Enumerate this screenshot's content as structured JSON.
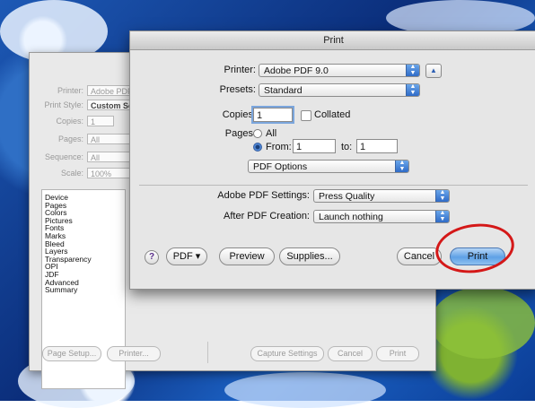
{
  "back_dialog": {
    "fields": [
      {
        "label": "Printer:",
        "value": "Adobe PDF"
      },
      {
        "label": "Print Style:",
        "value": "Custom Se"
      },
      {
        "label": "Copies:",
        "value": "1"
      },
      {
        "label": "Pages:",
        "value": "All"
      },
      {
        "label": "Sequence:",
        "value": "All"
      },
      {
        "label": "Scale:",
        "value": "100%"
      }
    ],
    "list_items": [
      "Device",
      "Pages",
      "Colors",
      "Pictures",
      "Fonts",
      "Marks",
      "Bleed",
      "Layers",
      "Transparency",
      "OPI",
      "JDF",
      "Advanced",
      "Summary"
    ],
    "buttons": {
      "page_setup": "Page Setup...",
      "printer": "Printer...",
      "capture_settings": "Capture Settings",
      "cancel": "Cancel",
      "print": "Print"
    }
  },
  "print_dialog": {
    "title": "Print",
    "printer_label": "Printer:",
    "printer_value": "Adobe PDF 9.0",
    "presets_label": "Presets:",
    "presets_value": "Standard",
    "copies_label": "Copies:",
    "copies_value": "1",
    "collated_label": "Collated",
    "pages_label": "Pages:",
    "all_label": "All",
    "from_label": "From:",
    "from_value": "1",
    "to_label": "to:",
    "to_value": "1",
    "section_value": "PDF Options",
    "pdf_settings_label": "Adobe PDF Settings:",
    "pdf_settings_value": "Press Quality",
    "after_label": "After PDF Creation:",
    "after_value": "Launch nothing",
    "help_label": "?",
    "pdf_button": "PDF ▾",
    "preview_button": "Preview",
    "supplies_button": "Supplies...",
    "cancel_button": "Cancel",
    "print_button": "Print"
  },
  "colors": {
    "accent": "#2f6bc7",
    "annotation": "#d41818",
    "background_blue": "#1d59b5",
    "splash_green": "#9ac833"
  }
}
